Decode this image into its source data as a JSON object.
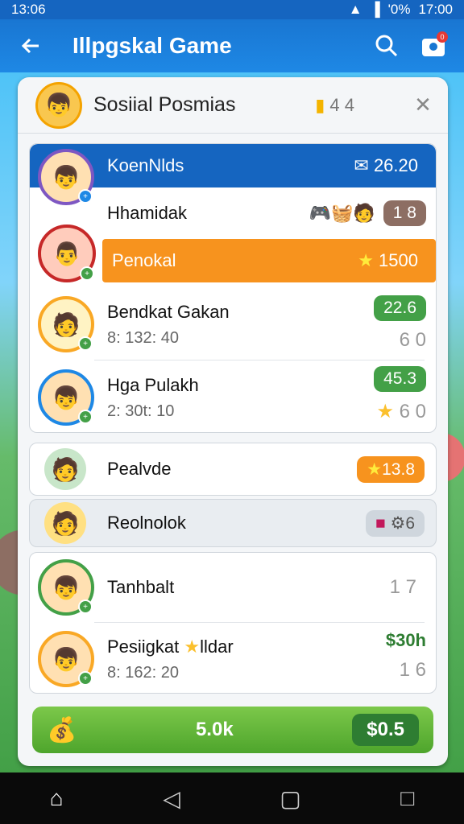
{
  "status": {
    "time": "13:06",
    "battery_text": "'0%",
    "clock_right": "17:00"
  },
  "app": {
    "title": "Illpgskal Game",
    "notif_count": "0"
  },
  "panel": {
    "title": "Sosiial Posmias",
    "extra": "4 4"
  },
  "leader": {
    "name": "KoenNlds",
    "score": "26.20"
  },
  "players": [
    {
      "name": "Hhamidak",
      "pill": "1 8"
    },
    {
      "name": "Penokal",
      "score": "1500"
    },
    {
      "name": "Bendkat Gakan",
      "sub": "8: 132: 40",
      "pill": "22.6",
      "faint": "6 0"
    },
    {
      "name": "Hga Pulakh",
      "sub": "2: 30t: 10",
      "pill": "45.3",
      "faint": "6 0"
    }
  ],
  "single_rows": [
    {
      "name": "Pealvde",
      "pill": "13.8"
    },
    {
      "name": "Reolnolok",
      "pill": "6"
    }
  ],
  "bottom_card": [
    {
      "name": "Tanhbalt",
      "faint": "1 7"
    },
    {
      "name": "Pesiigkat",
      "name_suffix": "lldar",
      "sub": "8: 162: 20",
      "amount": "$30h",
      "faint": "1 6"
    }
  ],
  "footer": {
    "amount": "5.0k",
    "button": "$0.5"
  },
  "colors": {
    "blue": "#1565c0",
    "orange": "#f7931e",
    "green": "#43a047"
  }
}
